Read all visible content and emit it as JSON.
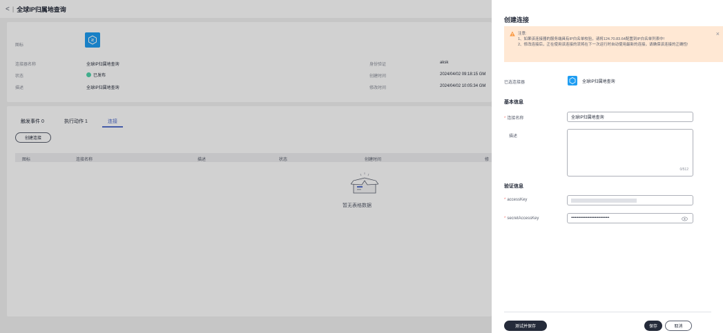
{
  "page": {
    "title": "全球IP归属地查询",
    "back_icon": "chevron-left-icon",
    "separator": "|"
  },
  "detail": {
    "icon_label": "图标",
    "name_label": "连接器名称",
    "name_value": "全球IP归属地查询",
    "status_label": "状态",
    "status_value": "已发布",
    "desc_label": "描述",
    "desc_value": "全球IP归属地查询",
    "auth_label": "身份验证",
    "auth_value": "aksk",
    "created_label": "创建时间",
    "created_value": "2024/04/02 09:18:15 GM",
    "modified_label": "修改时间",
    "modified_value": "2024/04/02 10:05:34 GM"
  },
  "tabs": [
    {
      "label": "触发事件 0"
    },
    {
      "label": "执行动作 1"
    },
    {
      "label": "连接"
    }
  ],
  "create_button": "创建连接",
  "table": {
    "columns": [
      "图标",
      "连接名称",
      "描述",
      "状态",
      "创建时间",
      "修"
    ]
  },
  "empty_text": "暂无表格数据",
  "drawer": {
    "title": "创建连接",
    "alert": {
      "heading": "注意:",
      "line1": "1、如果该连接器的服务端具有IP白名单校验，请将124.70.83.64配置到IP白名单列表中!",
      "line2": "2、修改连接后，正在使用该连接的流将在下一次运行时自动使用最新的连接，请确保该连接的正确性!",
      "close": "×"
    },
    "selected_label": "已选连接器",
    "selected_name": "全球IP归属地查询",
    "basic_title": "基本信息",
    "conn_name_label": "连接名称",
    "conn_name_value": "全球IP归属地查询",
    "desc_label": "描述",
    "desc_counter": "0/512",
    "auth_title": "验证信息",
    "access_key_label": "accessKey",
    "secret_key_label": "secretAccessKey",
    "secret_key_value": "••••••••••••••••••••••••••••••••••••••",
    "required_mark": "*",
    "test_save_button": "测试并保存",
    "save_button": "保存",
    "cancel_button": "取消"
  },
  "colors": {
    "accent": "#526ecc",
    "brand_blue": "#1e9df2",
    "success": "#50d4ab",
    "alert_bg": "#ffe8d4",
    "alert_icon": "#fa9841",
    "dark_button": "#252b3a"
  }
}
